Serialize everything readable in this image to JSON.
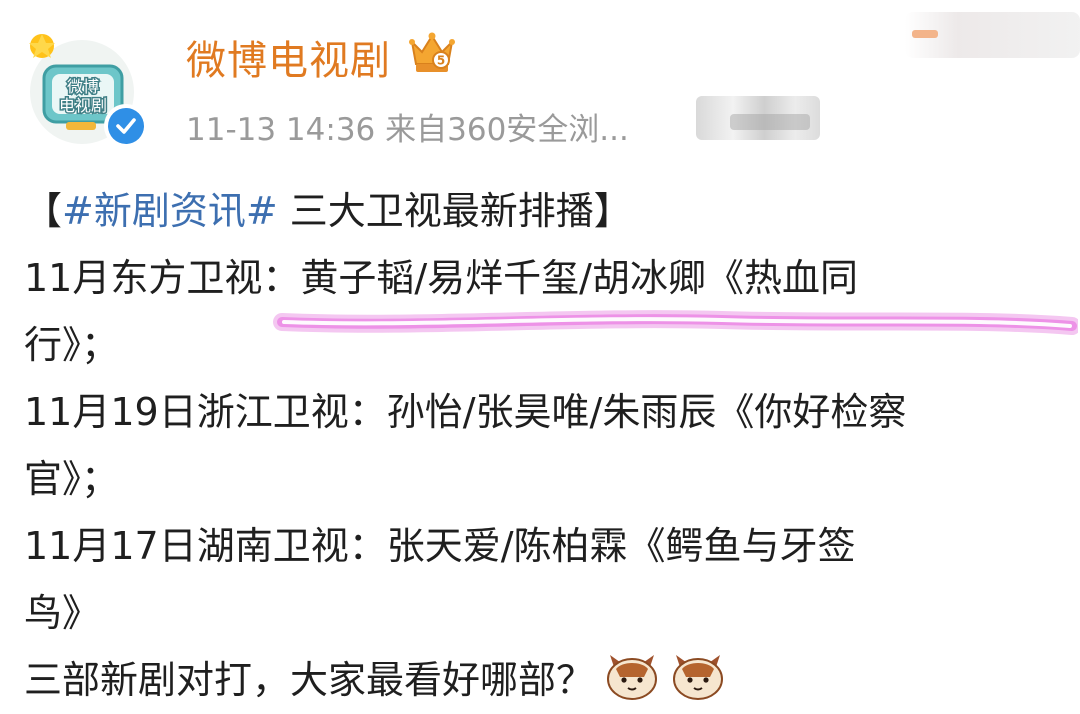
{
  "post": {
    "author": "微博电视剧",
    "avatar_text": [
      "微博",
      "电视剧"
    ],
    "meta": "11-13 14:36  来自360安全浏..."
  },
  "content": {
    "headline_open": "【",
    "hashtag": "#新剧资讯#",
    "headline_rest": " 三大卫视最新排播】",
    "line1": "11月东方卫视：黄子韬/易烊千玺/胡冰卿《热血同",
    "line1b": "行》；",
    "line2": "11月19日浙江卫视：孙怡/张昊唯/朱雨辰《你好检察",
    "line2b": "官》；",
    "line3": "11月17日湖南卫视：张天爱/陈柏霖《鳄鱼与牙签",
    "line3b": "鸟》",
    "closing": "三部新剧对打，大家最看好哪部？"
  },
  "colors": {
    "author": "#e07a21",
    "hashtag": "#3d6fb0",
    "meta": "#9a9a9a",
    "highlight": "#e05fd6",
    "verified": "#2f8fe6"
  },
  "icons": [
    "avatar-logo",
    "verified-icon",
    "crown-vip-icon",
    "cat-emoji-icon"
  ]
}
